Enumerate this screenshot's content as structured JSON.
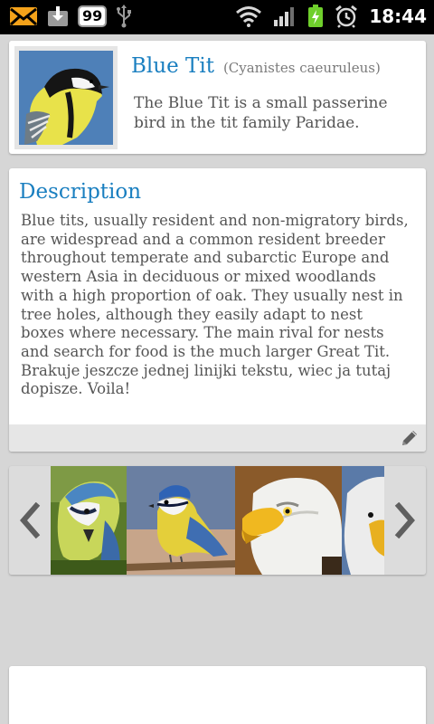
{
  "status_bar": {
    "notification_count": "99",
    "time": "18:44",
    "icons": [
      "mail-icon",
      "download-icon",
      "usb-icon",
      "wifi-icon",
      "signal-icon",
      "battery-charging-icon",
      "alarm-icon"
    ]
  },
  "bird": {
    "name": "Blue Tit",
    "scientific_name": "(Cyanistes caeuruleus)",
    "summary": "The Blue Tit is a small passerine bird in the tit family Paridae."
  },
  "description": {
    "title": "Description",
    "body": "Blue tits, usually resident and non-migratory birds, are widespread and a common resident breeder throughout temperate and subarctic Europe and western Asia in deciduous or mixed woodlands with a high proportion of oak. They usually nest in tree holes, although they easily adapt to nest boxes where necessary. The main rival for nests and search for food is the much larger Great Tit. Brakuje jeszcze jednej linijki tekstu, wiec ja tutaj dopisze. Voila!",
    "edit_icon": "pencil-icon"
  },
  "gallery": {
    "prev_icon": "chevron-left-icon",
    "next_icon": "chevron-right-icon",
    "photos": [
      "blue-tit-photo-1",
      "blue-tit-photo-2",
      "bald-eagle-photo-1",
      "bald-eagle-photo-2"
    ]
  },
  "colors": {
    "accent": "#1a7fc0",
    "background": "#d6d6d6",
    "card": "#ffffff",
    "status_bar": "#000000"
  }
}
